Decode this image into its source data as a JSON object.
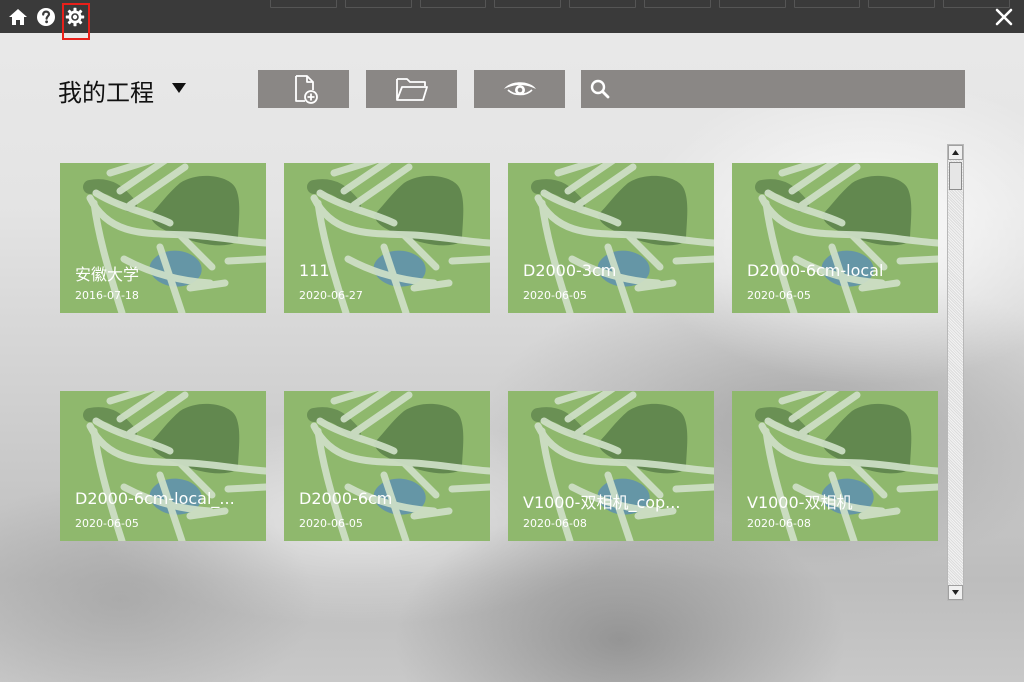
{
  "header": {
    "title": "我的工程",
    "search": {
      "value": "",
      "placeholder": ""
    }
  },
  "icons": {
    "home": "home-icon",
    "help": "help-icon",
    "settings": "gear-icon",
    "close": "close-icon",
    "new_project": "new-file-icon",
    "open_folder": "folder-icon",
    "view": "eye-icon",
    "search": "search-icon"
  },
  "colors": {
    "topbar": "#3a3a3a",
    "button": "#8a8785",
    "card": "#8fb86d",
    "highlight": "#e8201a"
  },
  "projects": [
    {
      "name": "安徽大学",
      "date": "2016-07-18"
    },
    {
      "name": "111",
      "date": "2020-06-27"
    },
    {
      "name": "D2000-3cm",
      "date": "2020-06-05"
    },
    {
      "name": "D2000-6cm-local",
      "date": "2020-06-05"
    },
    {
      "name": "D2000-6cm-local_...",
      "date": "2020-06-05"
    },
    {
      "name": "D2000-6cm",
      "date": "2020-06-05"
    },
    {
      "name": "V1000-双相机_cop...",
      "date": "2020-06-08"
    },
    {
      "name": "V1000-双相机",
      "date": "2020-06-08"
    }
  ]
}
